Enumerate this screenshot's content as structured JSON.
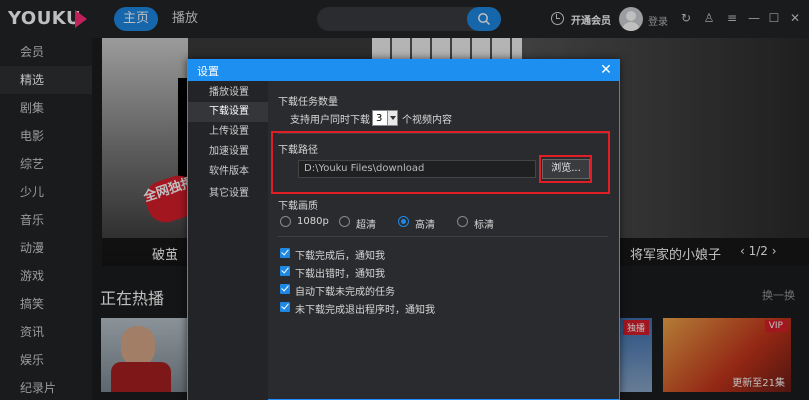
{
  "app": {
    "logo_text": "YOUKU"
  },
  "header": {
    "nav": [
      "主页",
      "播放"
    ],
    "search_placeholder": "",
    "vip_label": "开通会员",
    "login_label": "登录"
  },
  "sidebar": {
    "items": [
      "会员",
      "精选",
      "剧集",
      "电影",
      "综艺",
      "少儿",
      "音乐",
      "动漫",
      "游戏",
      "搞笑",
      "资讯",
      "娱乐",
      "纪录片"
    ],
    "active_index": 1
  },
  "banner": {
    "badge_text": "全网独播",
    "title_left": "破茧",
    "title_right": "将军家的小娘子",
    "pager": "1/2"
  },
  "hot": {
    "title": "正在热播",
    "refresh_label": "换一换",
    "thumbs": [
      {
        "tag": "",
        "overlay": ""
      },
      {
        "tag": "独播",
        "overlay": ""
      },
      {
        "tag": "VIP",
        "overlay": "更新至21集"
      }
    ]
  },
  "dialog": {
    "title": "设置",
    "menu": [
      "播放设置",
      "下载设置",
      "上传设置",
      "加速设置",
      "软件版本",
      "其它设置"
    ],
    "active_menu_index": 1,
    "task_count": {
      "heading": "下载任务数量",
      "prefix": "支持用户同时下载",
      "value": "3",
      "suffix": "个视频内容"
    },
    "path": {
      "heading": "下载路径",
      "value": "D:\\Youku Files\\download",
      "browse_label": "浏览..."
    },
    "quality": {
      "heading": "下载画质",
      "options": [
        "1080p",
        "超清",
        "高清",
        "标清"
      ],
      "selected_index": 2
    },
    "checkboxes": [
      {
        "label": "下载完成后，通知我",
        "checked": true
      },
      {
        "label": "下载出错时，通知我",
        "checked": true
      },
      {
        "label": "自动下载未完成的任务",
        "checked": true
      },
      {
        "label": "未下载完成退出程序时，通知我",
        "checked": true
      }
    ],
    "highlight_color": "#e01e25",
    "accent_color": "#1c8ff0"
  }
}
